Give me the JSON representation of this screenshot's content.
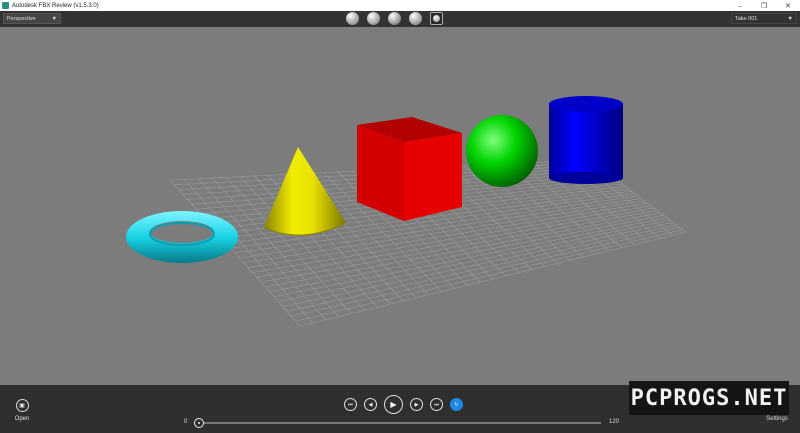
{
  "window": {
    "title": "Autodesk FBX Review (v1.5.3.0)",
    "controls": [
      "–",
      "❐",
      "✕"
    ]
  },
  "toolbar": {
    "view_mode": "Perspective",
    "take": "Take 001",
    "shading_icons": [
      "sphere-smooth-icon",
      "sphere-shaded-icon",
      "sphere-wireframe-icon",
      "sphere-lit-icon",
      "frame-selected-icon"
    ]
  },
  "scene": {
    "objects": [
      {
        "name": "torus",
        "color": "#18d4e6"
      },
      {
        "name": "cone",
        "color": "#e8e000"
      },
      {
        "name": "cube",
        "color": "#d40000"
      },
      {
        "name": "sphere",
        "color": "#00d400"
      },
      {
        "name": "cylinder",
        "color": "#0000e0"
      }
    ],
    "grid_color": "#9a9a9a"
  },
  "playback": {
    "first_glyph": "⏮",
    "prev_glyph": "◀",
    "play_glyph": "▶",
    "next_glyph": "▶",
    "last_glyph": "⏭",
    "loop_glyph": "↻",
    "range_min": "0",
    "range_max": "120",
    "current_frame": 0
  },
  "bottom": {
    "open_label": "Open",
    "settings_label": "Settings"
  },
  "watermark": "PCPROGS.NET",
  "colors": {
    "toolbar_bg": "#333333",
    "viewport_bg": "#7c7c7c",
    "bottombar_bg": "#2f2f2f",
    "accent": "#1e88e5"
  }
}
